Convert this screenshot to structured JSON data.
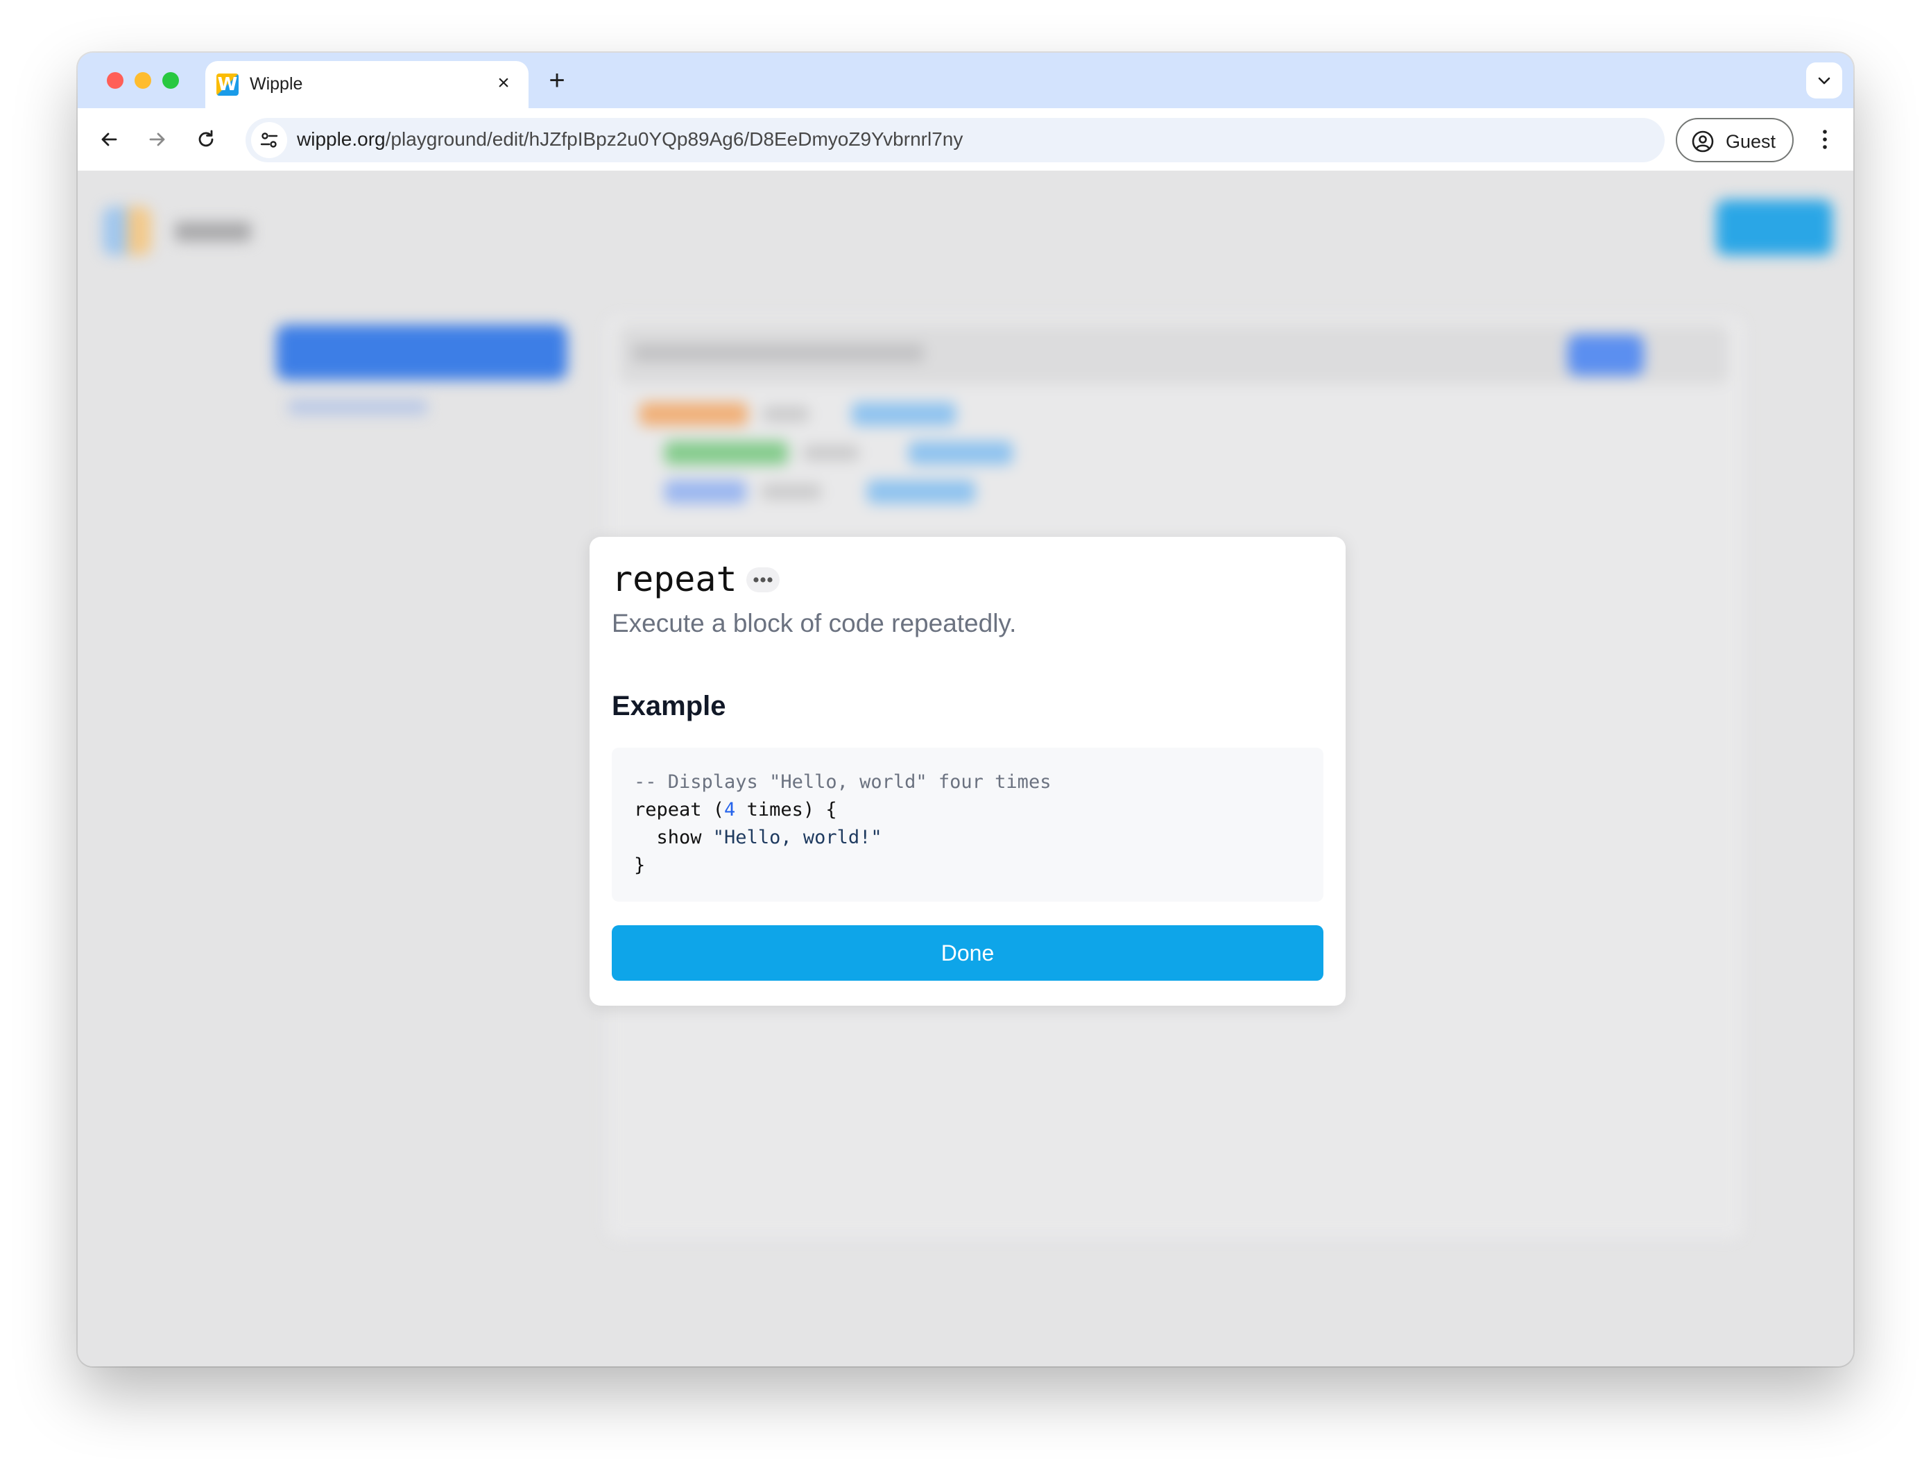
{
  "browser": {
    "tab": {
      "title": "Wipple",
      "favicon_letter": "W"
    },
    "new_tab_label": "+",
    "url": {
      "host": "wipple.org",
      "path": "/playground/edit/hJZfpIBpz2u0YQp89Ag6/D8EeDmyoZ9Yvbrnrl7ny"
    },
    "profile_label": "Guest"
  },
  "icons": {
    "tab_close": "×"
  },
  "modal": {
    "title": "repeat",
    "description": "Execute a block of code repeatedly.",
    "example_heading": "Example",
    "code": {
      "comment": "-- Displays \"Hello, world\" four times",
      "line2_a": "repeat (",
      "line2_num": "4",
      "line2_b": " times) {",
      "line3_a": "  show ",
      "line3_str": "\"Hello, world!\"",
      "line4": "}"
    },
    "done_label": "Done"
  },
  "colors": {
    "accent": "#0ea5e9",
    "tabstrip": "#d3e3fd",
    "overlay_bg": "#e4e4e5"
  }
}
